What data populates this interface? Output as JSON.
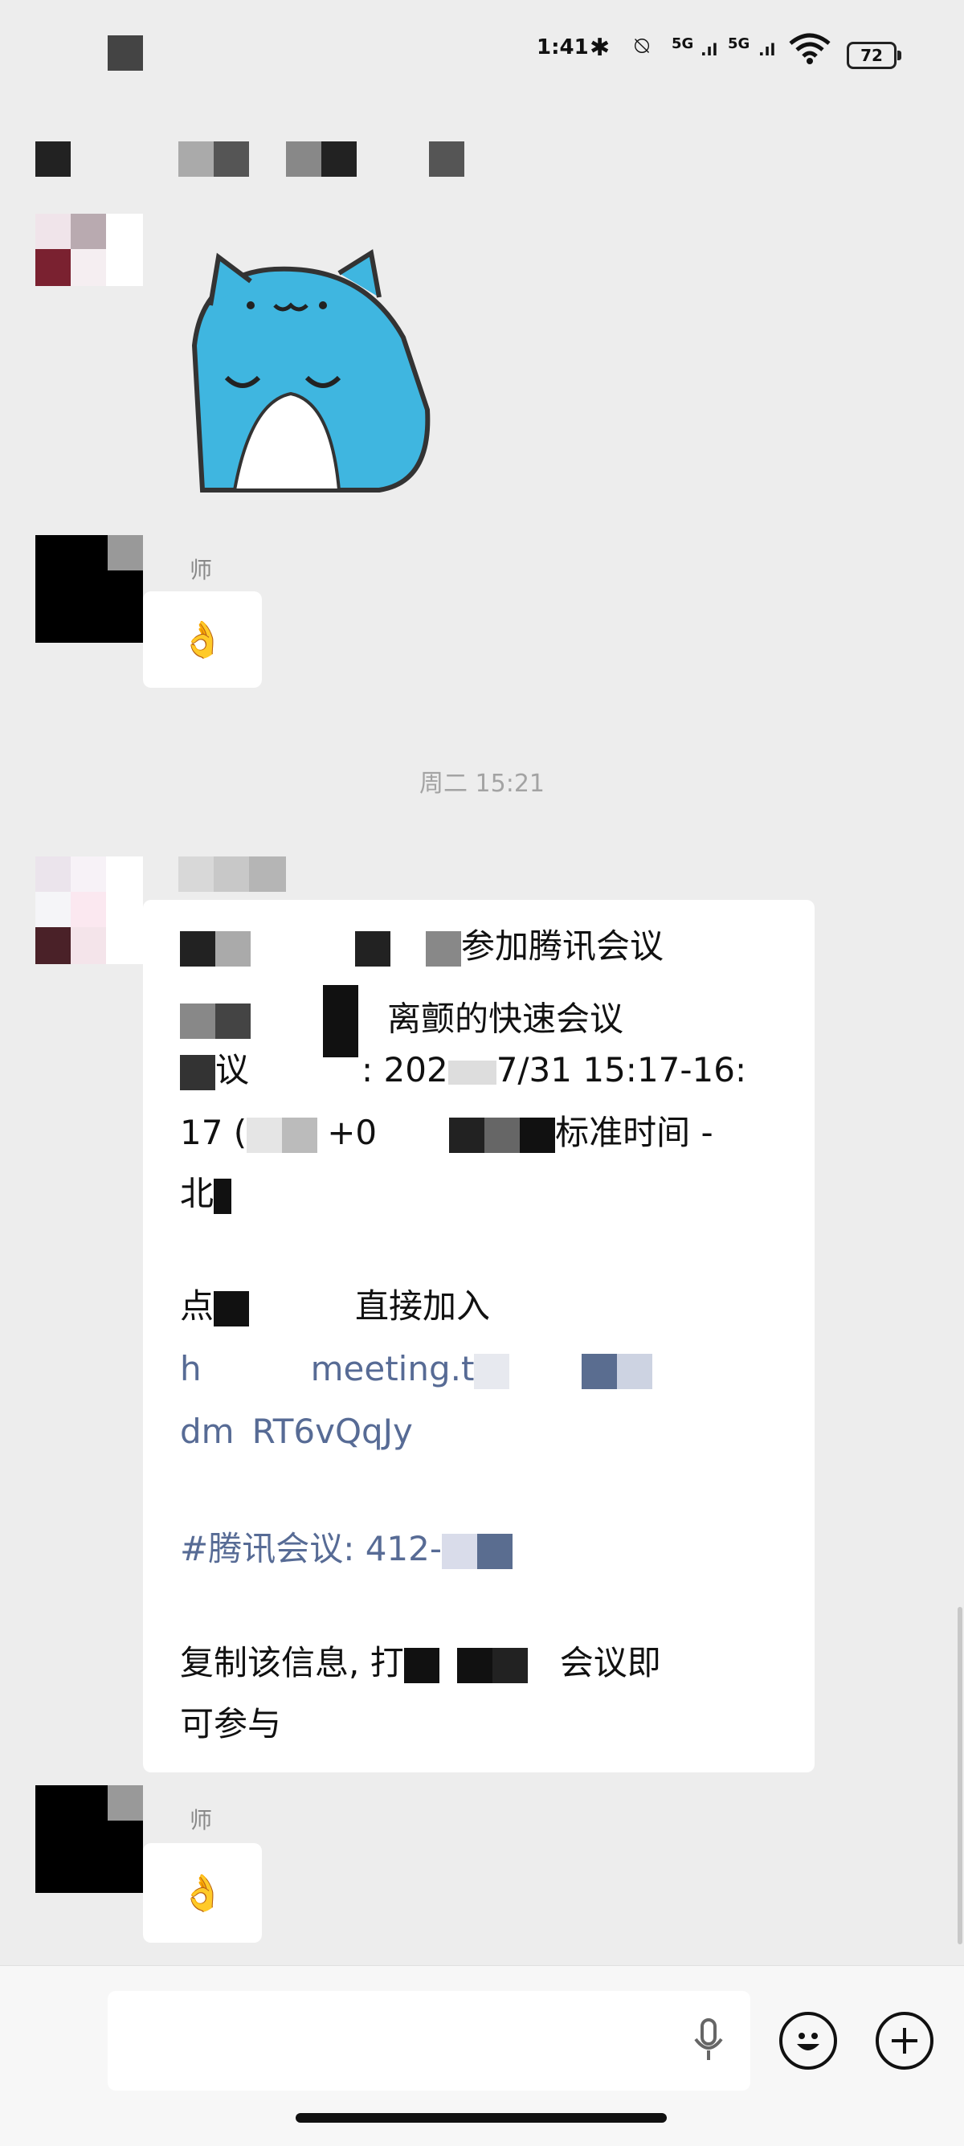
{
  "status_bar": {
    "time": "1:41",
    "network_a": "5G",
    "network_b": "5G",
    "battery": "72"
  },
  "icons": {
    "bluetooth": "bluetooth-icon",
    "mute": "bell-off-icon",
    "wifi": "wifi-icon",
    "mic": "microphone-icon",
    "emoji": "emoji-icon",
    "plus": "plus-icon"
  },
  "messages": {
    "msg2_sender": "师",
    "msg2_text": "👌",
    "timestamp": "周二 15:21",
    "meeting": {
      "line1": "参加腾讯会议",
      "line2": "离颤的快速会议",
      "line3_a": "议",
      "line3_b": ": 202",
      "line3_c": "7/31 15:17-16:",
      "line4_a": "17 (",
      "line4_b": "+0",
      "line4_c": "标准时间 -",
      "line5": "北",
      "join_a": "点",
      "join_b": "直接加入",
      "link_a": "h",
      "link_b": "meeting.t",
      "link_c": "dm",
      "link_d": "RT6vQqJy",
      "meeting_tag": "#腾讯会议: 412-",
      "copy_a": "复制该信息, 打",
      "copy_b": "会议即",
      "copy_c": "可参与"
    },
    "msg4_sender": "师",
    "msg4_text": "👌"
  },
  "colors": {
    "background": "#ededed",
    "bubble": "#ffffff",
    "link": "#576b95",
    "sticker": "#3fb6e0"
  }
}
